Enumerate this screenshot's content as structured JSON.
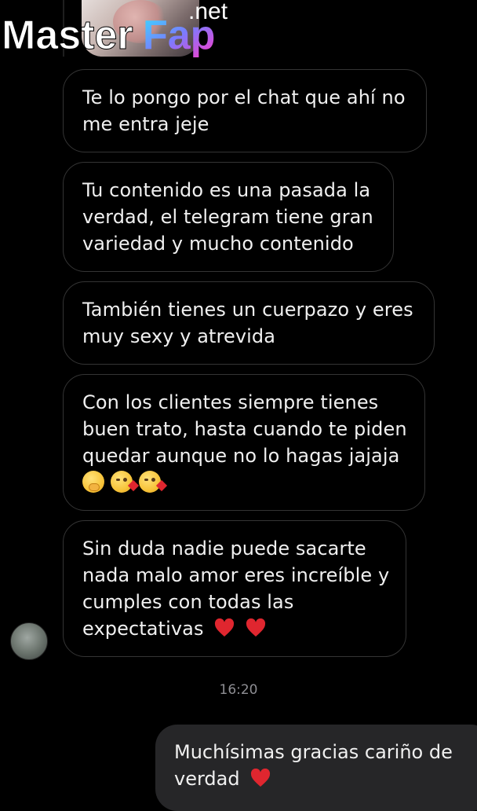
{
  "watermark": {
    "brand_main": "Master",
    "brand_accent": "Fap",
    "brand_tld": ".net"
  },
  "incoming_messages": [
    {
      "lines": [
        "Te lo pongo por el chat que ahí no",
        "me entra jeje"
      ]
    },
    {
      "lines": [
        "Tu contenido es una pasada la",
        "verdad, el telegram tiene gran",
        "variedad y mucho contenido"
      ]
    },
    {
      "lines": [
        "También tienes un cuerpazo y eres",
        "muy sexy y atrevida"
      ]
    },
    {
      "lines": [
        "Con los clientes siempre tienes",
        "buen trato, hasta cuando te piden",
        "quedar aunque no lo hagas jajaja"
      ],
      "emojis": [
        "face-with-hand-over-mouth",
        "face-blowing-kiss",
        "face-blowing-kiss"
      ]
    },
    {
      "lines": [
        "Sin duda nadie puede sacarte",
        "nada malo amor eres increíble y",
        "cumples con todas las",
        "expectativas"
      ],
      "trailing_emojis": [
        "red-heart",
        "red-heart"
      ]
    }
  ],
  "timestamp": "16:20",
  "outgoing_message": {
    "lines": [
      "Muchísimas gracias cariño de",
      "verdad"
    ],
    "trailing_emojis": [
      "red-heart"
    ]
  },
  "colors": {
    "background": "#000000",
    "incoming_border": "#343434",
    "outgoing_bg": "#262628",
    "timestamp": "#8e8e93",
    "heart": "#e0262f"
  }
}
